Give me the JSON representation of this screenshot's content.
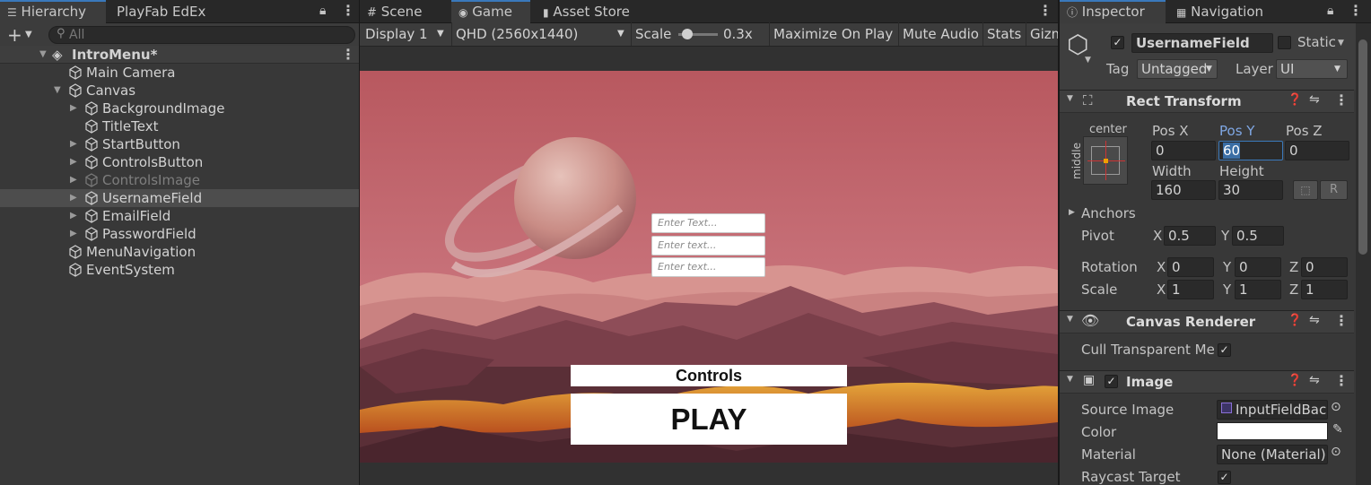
{
  "hierarchy": {
    "tab_label": "Hierarchy",
    "tab2_label": "PlayFab EdEx",
    "search_placeholder": "All",
    "scene_name": "IntroMenu*",
    "items": [
      {
        "label": "Main Camera"
      },
      {
        "label": "Canvas"
      },
      {
        "label": "BackgroundImage"
      },
      {
        "label": "TitleText"
      },
      {
        "label": "StartButton"
      },
      {
        "label": "ControlsButton"
      },
      {
        "label": "ControlsImage"
      },
      {
        "label": "UsernameField"
      },
      {
        "label": "EmailField"
      },
      {
        "label": "PasswordField"
      },
      {
        "label": "MenuNavigation"
      },
      {
        "label": "EventSystem"
      }
    ]
  },
  "game_view": {
    "tabs": [
      {
        "label": "Scene",
        "icon": "grid-icon"
      },
      {
        "label": "Game",
        "icon": "gamepad-icon"
      },
      {
        "label": "Asset Store",
        "icon": "bag-icon"
      }
    ],
    "display": "Display 1",
    "resolution": "QHD (2560x1440)",
    "scale_label": "Scale",
    "scale_value": "0.3x",
    "maximize": "Maximize On Play",
    "mute": "Mute Audio",
    "stats": "Stats",
    "gizmos": "Gizm",
    "fields": [
      "Enter Text...",
      "Enter text...",
      "Enter text..."
    ],
    "controls_button": "Controls",
    "play_button": "PLAY"
  },
  "inspector": {
    "tab_label": "Inspector",
    "tab2_label": "Navigation",
    "object_name": "UsernameField",
    "static_label": "Static",
    "tag_label": "Tag",
    "tag_value": "Untagged",
    "layer_label": "Layer",
    "layer_value": "UI",
    "rect_transform": {
      "title": "Rect Transform",
      "anchor_h": "center",
      "anchor_v": "middle",
      "pos_x_label": "Pos X",
      "pos_x": "0",
      "pos_y_label": "Pos Y",
      "pos_y": "60",
      "pos_z_label": "Pos Z",
      "pos_z": "0",
      "width_label": "Width",
      "width": "160",
      "height_label": "Height",
      "height": "30",
      "r_label": "R",
      "anchors_label": "Anchors",
      "pivot_label": "Pivot",
      "pivot_x": "0.5",
      "pivot_y": "0.5",
      "rotation_label": "Rotation",
      "rot_x": "0",
      "rot_y": "0",
      "rot_z": "0",
      "scale_label": "Scale",
      "scale_x": "1",
      "scale_y": "1",
      "scale_z": "1",
      "x": "X",
      "y": "Y",
      "z": "Z"
    },
    "canvas_renderer": {
      "title": "Canvas Renderer",
      "cull_label": "Cull Transparent Mes"
    },
    "image": {
      "title": "Image",
      "source_label": "Source Image",
      "source_value": "InputFieldBack",
      "color_label": "Color",
      "material_label": "Material",
      "material_value": "None (Material)",
      "raycast_label": "Raycast Target"
    }
  },
  "colors": {
    "accent": "#3a79bb",
    "selection": "#4d4d4d",
    "sky_top": "#c06769",
    "lava": "#e68a1a"
  }
}
